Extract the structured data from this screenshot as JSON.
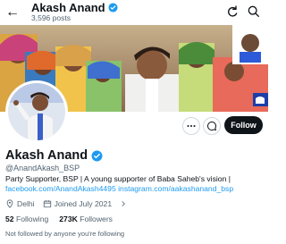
{
  "header": {
    "name": "Akash Anand",
    "posts": "3,596 posts",
    "back_icon": "back-arrow-icon",
    "refresh_icon": "refresh-icon",
    "search_icon": "search-icon"
  },
  "profile": {
    "name": "Akash Anand",
    "handle": "@AnandAkash_BSP",
    "bio_text": "Party Supporter, BSP | A young supporter of Baba Saheb's vision |",
    "bio_link_1": "facebook.com/AnandAkash4495",
    "bio_link_2": "instagram.com/aakashanand_bsp",
    "location": "Delhi",
    "joined": "Joined July 2021",
    "following_count": "52",
    "following_label": "Following",
    "followers_count": "273K",
    "followers_label": "Followers",
    "followed_by": "Not followed by anyone you're following"
  },
  "actions": {
    "more_icon": "more-icon",
    "message_icon": "message-icon",
    "follow_label": "Follow"
  },
  "colors": {
    "accent": "#1d9bf0",
    "text": "#0f1419",
    "secondary": "#536471",
    "follow_bg": "#0f1419"
  }
}
